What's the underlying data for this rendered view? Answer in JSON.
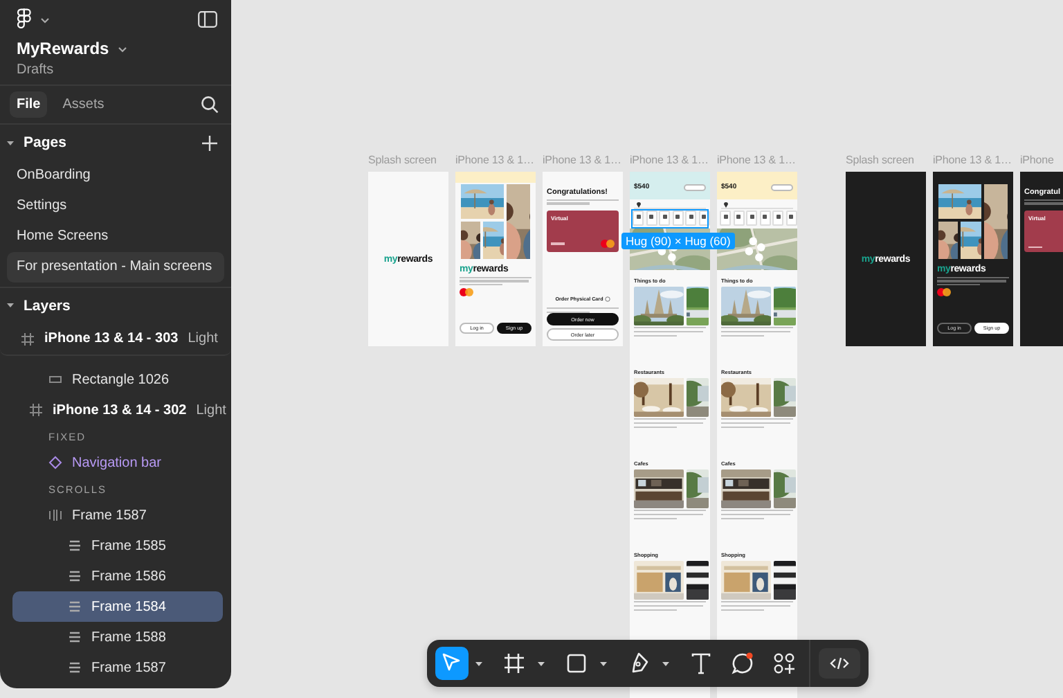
{
  "sidebar": {
    "file_name": "MyRewards",
    "location": "Drafts",
    "tabs": [
      {
        "label": "File",
        "selected": true
      },
      {
        "label": "Assets",
        "selected": false
      }
    ],
    "pages": {
      "title": "Pages",
      "expanded": true,
      "items": [
        {
          "label": "OnBoarding",
          "selected": false
        },
        {
          "label": "Settings",
          "selected": false
        },
        {
          "label": "Home Screens",
          "selected": false
        },
        {
          "label": "For presentation - Main screens",
          "selected": true
        }
      ]
    },
    "layers": {
      "title": "Layers",
      "expanded": true,
      "items": [
        {
          "kind": "frame",
          "name": "iPhone 13 & 14 - 303",
          "variant": "Light",
          "selected": false,
          "children": [
            {
              "kind": "rectangle",
              "name": "Rectangle 1026",
              "selected": false
            }
          ]
        },
        {
          "kind": "frame",
          "name": "iPhone 13 & 14 - 302",
          "variant": "Light",
          "selected": false,
          "children": [
            {
              "kind": "section",
              "name": "FIXED"
            },
            {
              "kind": "component",
              "name": "Navigation bar",
              "selected": false
            },
            {
              "kind": "section",
              "name": "SCROLLS"
            },
            {
              "kind": "row",
              "name": "Frame 1587",
              "selected": false,
              "children": [
                {
                  "kind": "column",
                  "name": "Frame 1585",
                  "selected": false
                },
                {
                  "kind": "column",
                  "name": "Frame 1586",
                  "selected": false
                },
                {
                  "kind": "column",
                  "name": "Frame 1584",
                  "selected": true
                },
                {
                  "kind": "column",
                  "name": "Frame 1588",
                  "selected": false
                },
                {
                  "kind": "column",
                  "name": "Frame 1587",
                  "selected": false
                }
              ]
            }
          ]
        }
      ]
    }
  },
  "canvas": {
    "groups": [
      {
        "frames": [
          {
            "label": "Splash screen",
            "dark": false,
            "kind": "splash",
            "logo": {
              "accent": "my",
              "rest": "rewards"
            }
          },
          {
            "label": "iPhone 13 & 1…",
            "dark": false,
            "kind": "intro",
            "color": "#fcefc6",
            "logo": {
              "accent": "my",
              "rest": "rewards"
            },
            "buttons": [
              {
                "label": "Log in",
                "kind": "outline"
              },
              {
                "label": "Sign up",
                "kind": "filled"
              }
            ]
          },
          {
            "label": "iPhone 13 & 1…",
            "dark": false,
            "kind": "card",
            "heading": "Congratulations!",
            "card_label": "Virtual",
            "card_brand": true,
            "subheading": "Order Physical Card",
            "buttons": [
              {
                "label": "Order now",
                "kind": "filled"
              },
              {
                "label": "Order later",
                "kind": "outline"
              }
            ]
          },
          {
            "label": "iPhone 13 & 1…",
            "dark": false,
            "kind": "home",
            "color": "#d5eeee",
            "balance": "$540",
            "sections": [
              "Things to do",
              "Restaurants",
              "Cafes",
              "Shopping"
            ],
            "selection_badge": "Hug (90) × Hug (60)"
          },
          {
            "label": "iPhone 13 & 1…",
            "dark": false,
            "kind": "home",
            "color": "#fcefc6",
            "balance": "$540",
            "sections": [
              "Things to do",
              "Restaurants",
              "Cafes",
              "Shopping"
            ]
          }
        ]
      },
      {
        "frames": [
          {
            "label": "Splash screen",
            "dark": true,
            "kind": "splash",
            "logo": {
              "accent": "my",
              "rest": "rewards"
            }
          },
          {
            "label": "iPhone 13 & 1…",
            "dark": true,
            "kind": "intro",
            "logo": {
              "accent": "my",
              "rest": "rewards"
            },
            "buttons": [
              {
                "label": "Log in",
                "kind": "outline"
              },
              {
                "label": "Sign up",
                "kind": "filled"
              }
            ]
          },
          {
            "label": "iPhone",
            "dark": true,
            "kind": "card",
            "heading": "Congratul",
            "card_label": "Virtual"
          }
        ]
      }
    ]
  },
  "toolbar": {
    "tools": [
      {
        "kind": "move",
        "selected": true,
        "menu": true
      },
      {
        "kind": "frame",
        "selected": false,
        "menu": true
      },
      {
        "kind": "shape",
        "selected": false,
        "menu": true
      },
      {
        "kind": "pen",
        "selected": false,
        "menu": true
      },
      {
        "kind": "text",
        "selected": false,
        "menu": false
      },
      {
        "kind": "comment",
        "selected": false,
        "menu": false
      },
      {
        "kind": "actions",
        "selected": false,
        "menu": false
      }
    ],
    "dev_mode": {
      "kind": "code"
    }
  }
}
